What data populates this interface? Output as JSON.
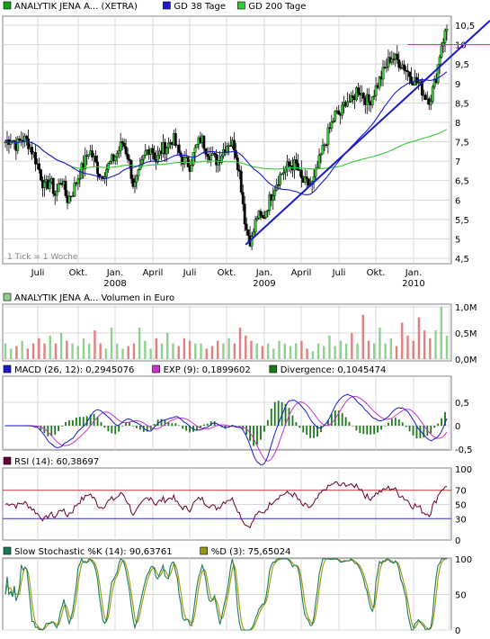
{
  "chart_data": [
    {
      "type": "candlestick",
      "legend": [
        {
          "label": "ANALYTIK JENA A... (XETRA)",
          "color": "#1a9e1a"
        },
        {
          "label": "GD 38 Tage",
          "color": "#1a1acc"
        },
        {
          "label": "GD 200 Tage",
          "color": "#33cc33"
        }
      ],
      "y_ticks": [
        "4,5",
        "5",
        "5,5",
        "6",
        "6,5",
        "7",
        "7,5",
        "8",
        "8,5",
        "9",
        "9,5",
        "10",
        "10,5"
      ],
      "y_tick_values": [
        4.5,
        5,
        5.5,
        6,
        6.5,
        7,
        7.5,
        8,
        8.5,
        9,
        9.5,
        10,
        10.5
      ],
      "ylim": [
        4.5,
        10.5
      ],
      "x_ticks": [
        {
          "label": "Juli",
          "year": ""
        },
        {
          "label": "Okt.",
          "year": ""
        },
        {
          "label": "Jan.",
          "year": "2008"
        },
        {
          "label": "April",
          "year": ""
        },
        {
          "label": "Juli",
          "year": ""
        },
        {
          "label": "Okt.",
          "year": ""
        },
        {
          "label": "Jan.",
          "year": "2009"
        },
        {
          "label": "April",
          "year": ""
        },
        {
          "label": "Juli",
          "year": ""
        },
        {
          "label": "Okt.",
          "year": ""
        },
        {
          "label": "Jan.",
          "year": "2010"
        },
        {
          "label": "",
          "year": ""
        }
      ],
      "note": "1 Tick = 1 Woche",
      "price_path": [
        7.5,
        7.6,
        7.4,
        7.6,
        7.5,
        7.2,
        6.8,
        6.3,
        6.5,
        6.1,
        6.6,
        6.0,
        6.2,
        6.6,
        6.9,
        7.3,
        7.0,
        6.6,
        6.8,
        7.0,
        7.2,
        7.5,
        7.1,
        6.3,
        6.7,
        7.2,
        7.4,
        7.0,
        7.3,
        7.4,
        7.6,
        7.2,
        7.0,
        6.9,
        7.3,
        7.6,
        7.3,
        7.1,
        7.0,
        7.3,
        7.5,
        7.4,
        6.6,
        5.3,
        4.9,
        5.6,
        5.5,
        5.9,
        6.3,
        6.6,
        6.8,
        6.9,
        6.9,
        6.5,
        6.4,
        6.4,
        6.9,
        7.4,
        7.8,
        8.2,
        8.2,
        8.6,
        8.5,
        8.9,
        8.7,
        8.5,
        8.8,
        9.1,
        9.4,
        9.7,
        9.6,
        9.5,
        9.3,
        9.1,
        9.0,
        8.7,
        8.6,
        9.1,
        10.0,
        10.4
      ],
      "trend_lines": [
        {
          "color": "#1a1acc",
          "points": [
            [
              43,
              4.85
            ],
            [
              79,
              9.6
            ]
          ]
        },
        {
          "color": "#cc33cc",
          "points": [
            [
              72,
              10.0
            ],
            [
              79,
              10.0
            ]
          ]
        }
      ]
    },
    {
      "type": "bar",
      "legend": [
        {
          "label": "ANALYTIK JENA A... Volumen in Euro",
          "color": "#8fd18f"
        }
      ],
      "y_ticks": [
        "0,0M",
        "0,5M",
        "1,0M"
      ],
      "ylim": [
        0,
        1.0
      ],
      "volumes": [
        0.3,
        0.2,
        0.25,
        0.35,
        0.2,
        0.3,
        0.4,
        0.3,
        0.45,
        0.3,
        0.5,
        0.35,
        0.3,
        0.25,
        0.4,
        0.3,
        0.55,
        0.3,
        0.2,
        0.6,
        0.3,
        0.2,
        0.25,
        0.3,
        0.6,
        0.35,
        0.2,
        0.4,
        0.3,
        0.5,
        0.3,
        0.25,
        0.4,
        0.35,
        0.3,
        0.3,
        0.2,
        0.25,
        0.35,
        0.3,
        0.4,
        0.3,
        0.6,
        0.45,
        0.35,
        0.3,
        0.25,
        0.3,
        0.2,
        0.35,
        0.3,
        0.25,
        0.3,
        0.35,
        0.2,
        0.15,
        0.3,
        0.25,
        0.45,
        0.25,
        0.35,
        0.3,
        0.5,
        0.3,
        0.85,
        0.35,
        0.3,
        0.6,
        0.3,
        0.4,
        0.25,
        0.7,
        0.45,
        0.35,
        0.8,
        0.55,
        0.4,
        0.55,
        1.0,
        0.45
      ]
    },
    {
      "type": "line",
      "legend": [
        {
          "label": "MACD (26, 12): 0,2945076",
          "color": "#1a1acc"
        },
        {
          "label": "EXP (9): 0,1899602",
          "color": "#cc33cc"
        },
        {
          "label": "Divergence: 0,1045474",
          "color": "#1a7a1a"
        }
      ],
      "y_ticks": [
        "-0,5",
        "0",
        "0,5"
      ],
      "ylim": [
        -0.6,
        0.7
      ]
    },
    {
      "type": "line",
      "legend": [
        {
          "label": "RSI (14): 60,38697",
          "color": "#660033"
        }
      ],
      "y_ticks": [
        "0",
        "30",
        "50",
        "70",
        "100"
      ],
      "levels": [
        30,
        70
      ],
      "ylim": [
        0,
        100
      ]
    },
    {
      "type": "line",
      "legend": [
        {
          "label": "Slow Stochastic %K (14): 90,63761",
          "color": "#1a7a5a"
        },
        {
          "label": "%D (3): 75,65024",
          "color": "#999900"
        }
      ],
      "y_ticks": [
        "0",
        "50",
        "100"
      ],
      "ylim": [
        0,
        100
      ]
    }
  ]
}
